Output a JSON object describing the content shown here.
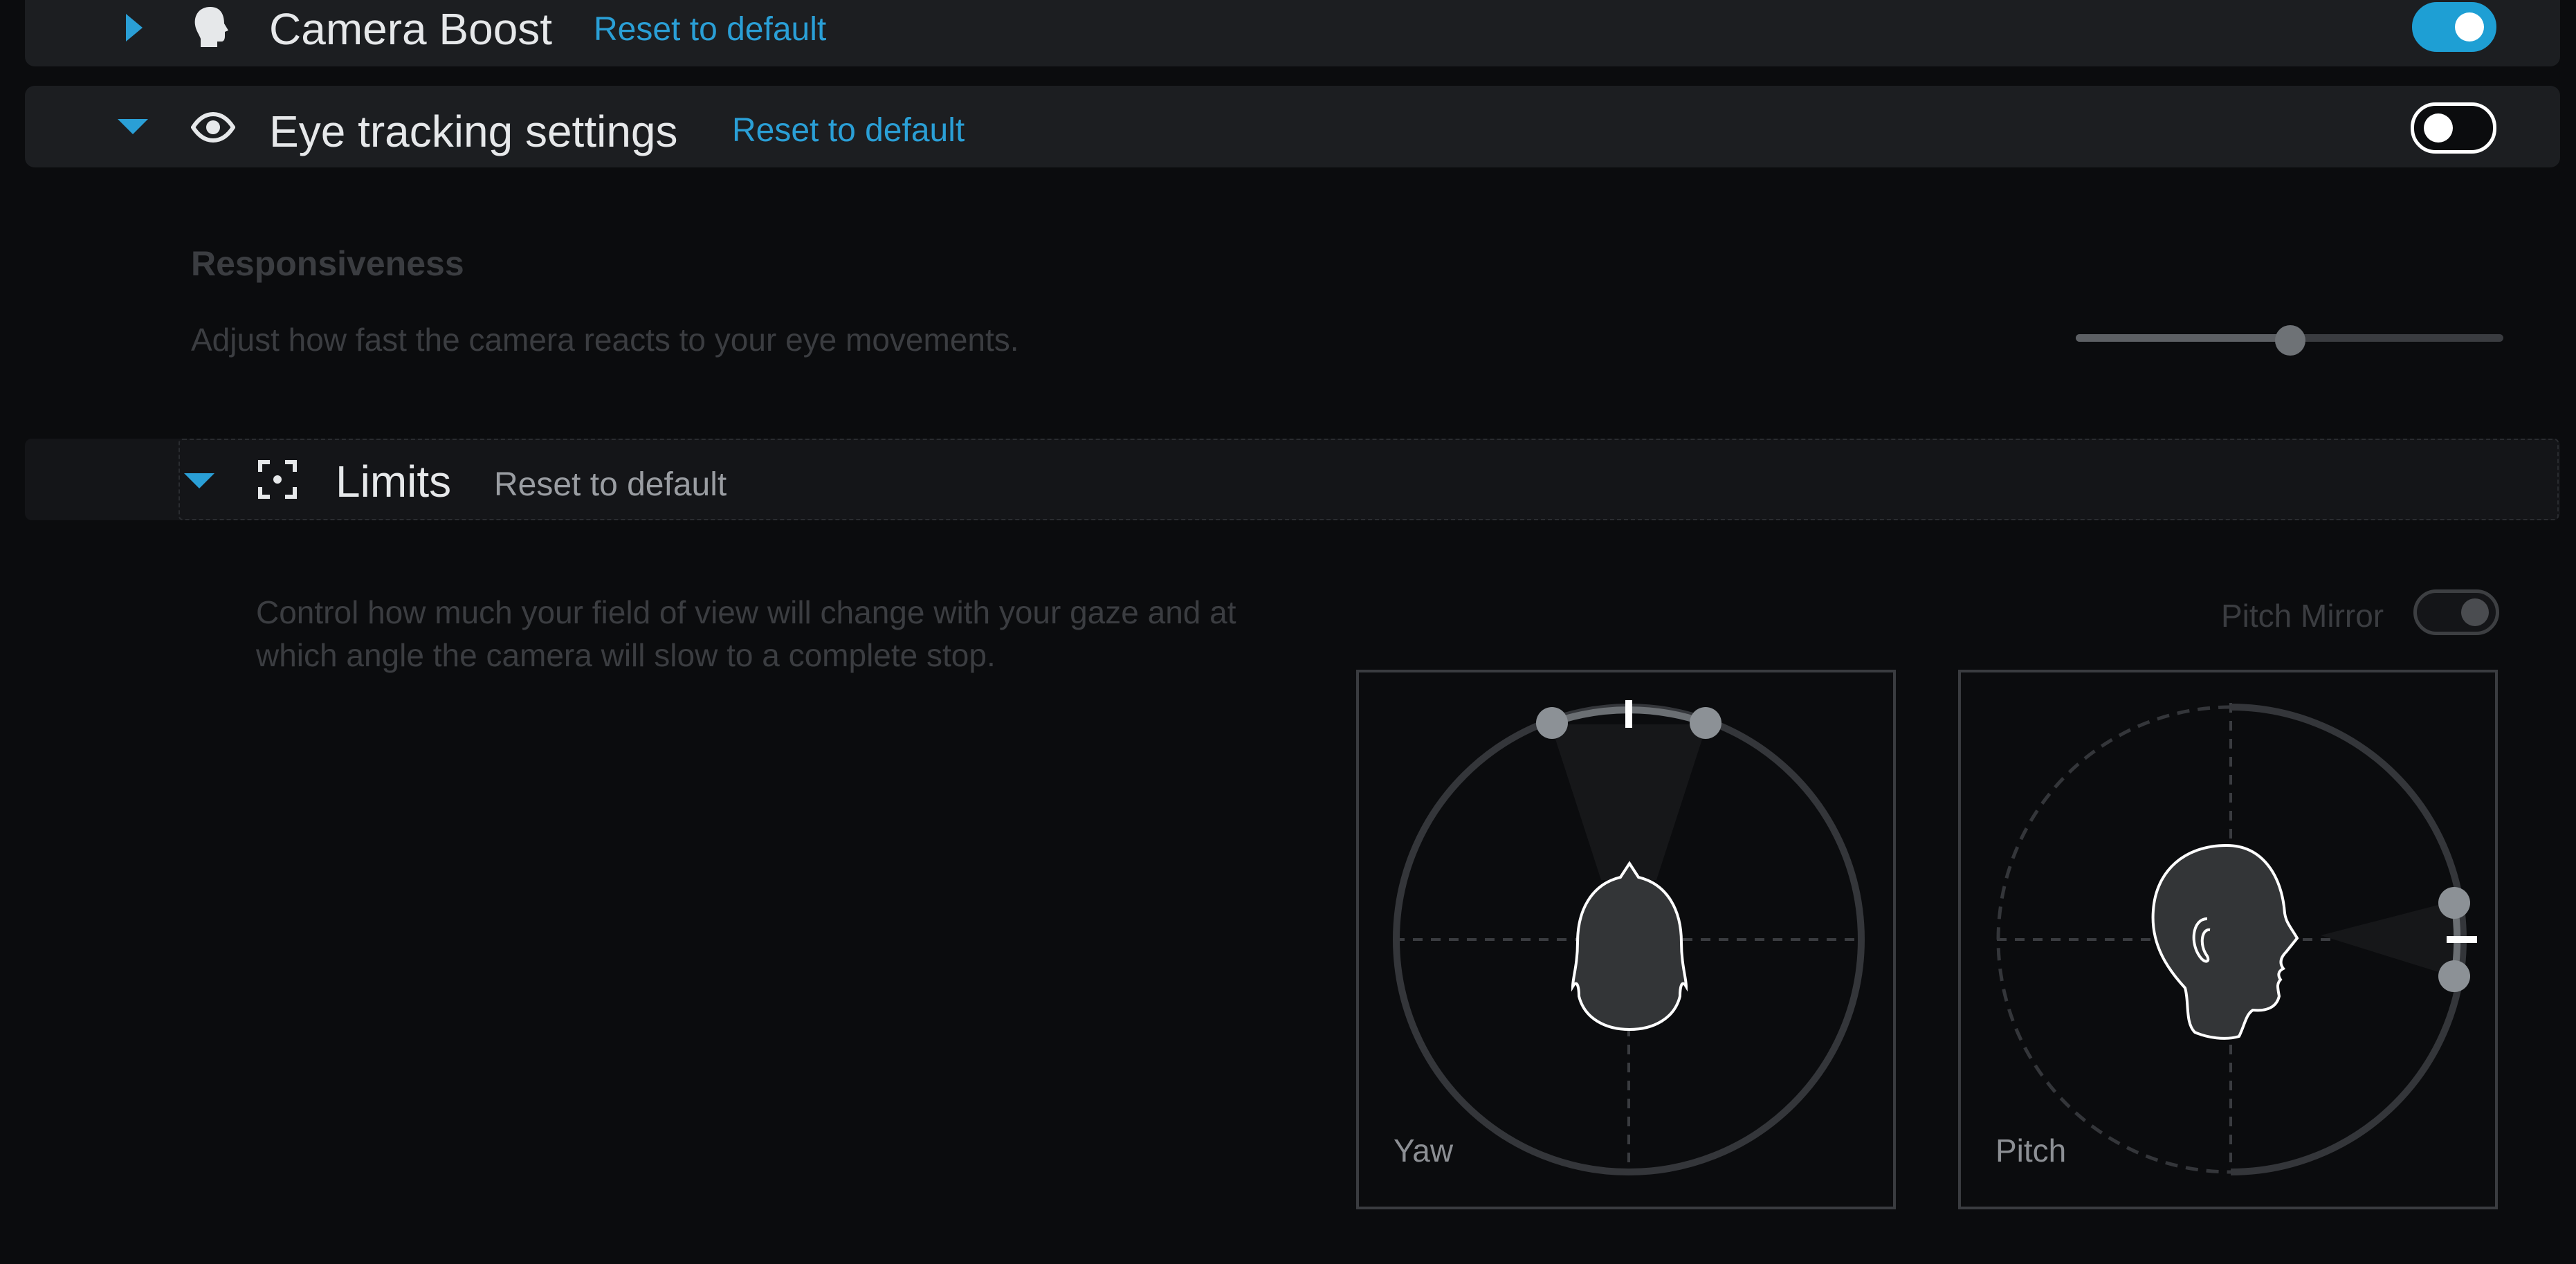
{
  "sections": {
    "camera_boost": {
      "title": "Camera Boost",
      "reset_label": "Reset to default",
      "expanded": false,
      "enabled": true,
      "icon": "head-icon"
    },
    "eye_tracking": {
      "title": "Eye tracking settings",
      "reset_label": "Reset to default",
      "expanded": true,
      "enabled": false,
      "icon": "eye-icon"
    }
  },
  "responsiveness": {
    "title": "Responsiveness",
    "description": "Adjust how fast the camera reacts to your eye movements.",
    "slider_value_fraction": 0.5
  },
  "limits": {
    "title": "Limits",
    "reset_label": "Reset to default",
    "expanded": true,
    "icon": "focus-frame-icon",
    "description_line1": "Control how much your field of view will change with your gaze and at",
    "description_line2": "which angle the camera will slow to a complete stop.",
    "pitch_mirror_label": "Pitch Mirror",
    "pitch_mirror_enabled": false,
    "yaw_label": "Yaw",
    "pitch_label": "Pitch"
  },
  "colors": {
    "accent": "#2a9fd6",
    "background": "#0b0c0e",
    "header_bg": "#1c1e21",
    "dim_text": "#3b3d41"
  }
}
